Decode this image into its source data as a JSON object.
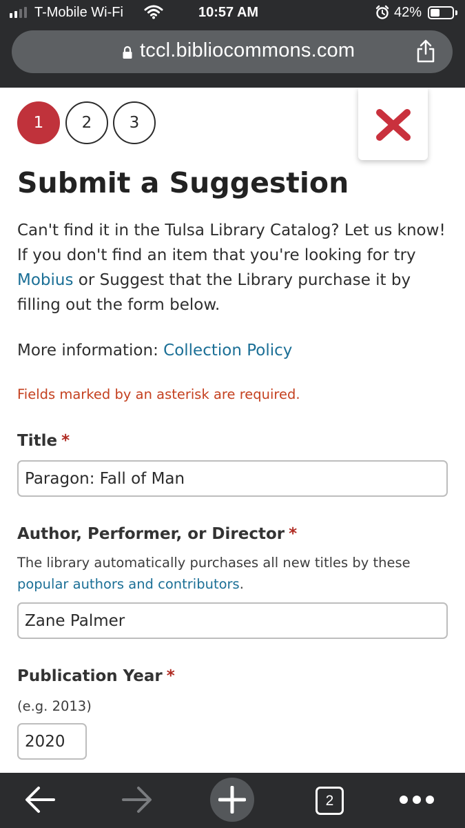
{
  "status_bar": {
    "carrier": "T-Mobile Wi-Fi",
    "time": "10:57 AM",
    "battery": "42%",
    "battery_level": 0.42
  },
  "browser": {
    "url": "tccl.bibliocommons.com",
    "open_tabs": "2"
  },
  "steps": [
    "1",
    "2",
    "3"
  ],
  "active_step": "1",
  "page": {
    "title": "Submit a Suggestion",
    "intro_line1": "Can't find it in the Tulsa Library Catalog? Let us know!",
    "intro_line2": "If you don't find an item that you're looking for try",
    "intro_link": "Mobius",
    "intro_line3_rest": " or Suggest that the Library purchase it by",
    "intro_line4": "filling out the form below.",
    "more_info_label": "More information: ",
    "more_info_link": "Collection Policy",
    "required_note": "Fields marked by an asterisk are required.",
    "required_marker": "*"
  },
  "form": {
    "title": {
      "label": "Title",
      "value": "Paragon: Fall of Man"
    },
    "author": {
      "label": "Author, Performer, or Director",
      "help_text": "The library automatically purchases all new titles by these",
      "help_link": "popular authors and contributors",
      "help_suffix": ".",
      "value": "Zane Palmer"
    },
    "year": {
      "label": "Publication Year",
      "help_text": "(e.g. 2013)",
      "value": "2020"
    }
  },
  "colors": {
    "accent": "#c0323b",
    "link": "#1b6f96",
    "required": "#c4401f",
    "chrome": "#2b2c2e",
    "url_bar": "#5d6063"
  },
  "icons": [
    "signal-icon",
    "wifi-icon",
    "alarm-icon",
    "battery-icon",
    "lock-icon",
    "share-icon",
    "close-icon",
    "back-arrow-icon",
    "forward-arrow-icon",
    "new-tab-plus-icon",
    "tabs-icon",
    "more-icon"
  ]
}
